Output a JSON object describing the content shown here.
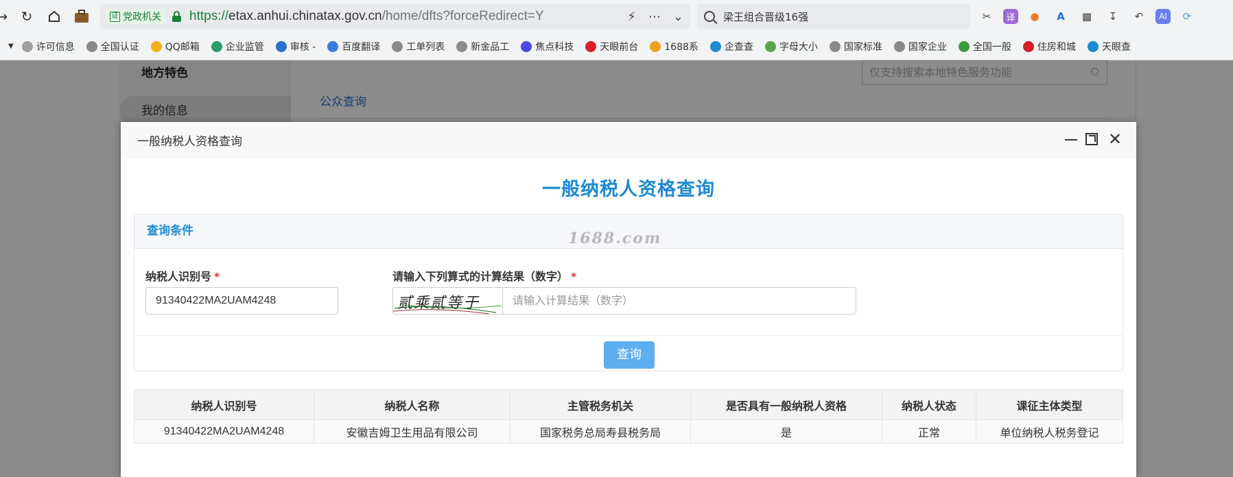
{
  "browser": {
    "gov_badge": "党政机关",
    "url_scheme": "https://",
    "url_host": "etax.anhui.chinatax.gov.cn",
    "url_path": "/home/dfts?forceRedirect=Y",
    "search_text": "梁王组合晋级16强"
  },
  "bookmarks": [
    {
      "label": "许可信息",
      "color": "#9e9e9e"
    },
    {
      "label": "全国认证",
      "color": "#8a8a8a"
    },
    {
      "label": "QQ邮箱",
      "color": "#f2b01e"
    },
    {
      "label": "企业监管",
      "color": "#2b9c6c"
    },
    {
      "label": "审核 -",
      "color": "#2a6fc9"
    },
    {
      "label": "百度翻译",
      "color": "#3a7de0"
    },
    {
      "label": "工单列表",
      "color": "#8a8a8a"
    },
    {
      "label": "新金品工",
      "color": "#8a8a8a"
    },
    {
      "label": "焦点科技",
      "color": "#4a4ae0"
    },
    {
      "label": "天眼前台",
      "color": "#d61f26"
    },
    {
      "label": "1688系",
      "color": "#f0a020"
    },
    {
      "label": "企查查",
      "color": "#1e8ad2"
    },
    {
      "label": "字母大小",
      "color": "#5aa34a"
    },
    {
      "label": "国家标准",
      "color": "#8a8a8a"
    },
    {
      "label": "国家企业",
      "color": "#8a8a8a"
    },
    {
      "label": "全国一般",
      "color": "#3c9c3c"
    },
    {
      "label": "住房和城",
      "color": "#d61f26"
    },
    {
      "label": "天眼查",
      "color": "#1e8ad2"
    }
  ],
  "page": {
    "sidebar_title": "地方特色",
    "sidebar_item": "我的信息",
    "search_placeholder": "仅支持搜索本地特色服务功能",
    "public_query_link": "公众查询"
  },
  "dialog": {
    "window_title": "一般纳税人资格查询",
    "heading": "一般纳税人资格查询",
    "panel_title": "查询条件",
    "watermark": "1688.com",
    "taxpayer_id_label": "纳税人识别号",
    "taxpayer_id_value": "91340422MA2UAM4248",
    "calc_label": "请输入下列算式的计算结果（数字）",
    "captcha_text": "贰乘贰等于",
    "calc_placeholder": "请输入计算结果（数字）",
    "required_mark": "*",
    "query_button": "查询"
  },
  "results": {
    "headers": [
      "纳税人识别号",
      "纳税人名称",
      "主管税务机关",
      "是否具有一般纳税人资格",
      "纳税人状态",
      "课征主体类型"
    ],
    "rows": [
      [
        "91340422MA2UAM4248",
        "安徽吉姆卫生用品有限公司",
        "国家税务总局寿县税务局",
        "是",
        "正常",
        "单位纳税人税务登记"
      ]
    ]
  }
}
